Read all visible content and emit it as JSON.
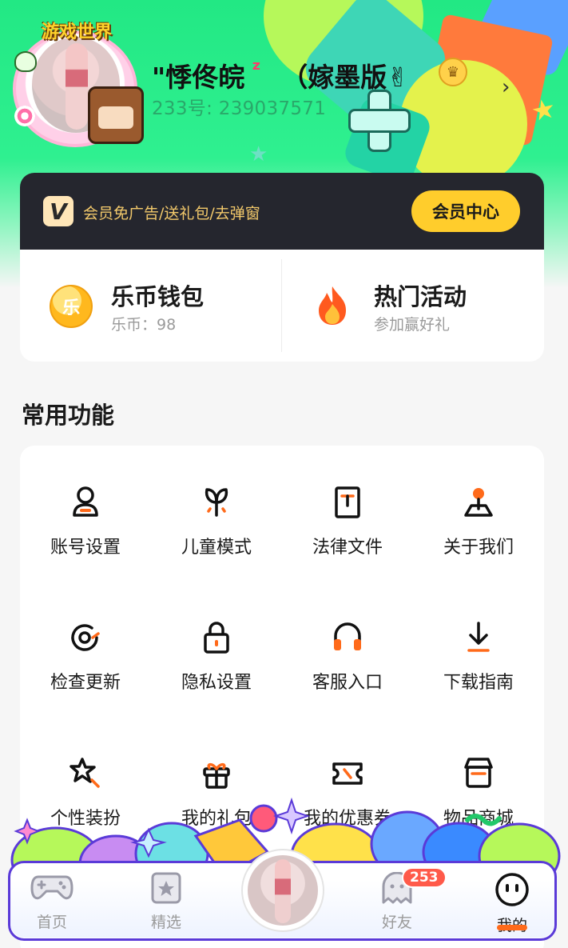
{
  "profile": {
    "username": "\"悸佟皖",
    "username_suffix": "（嫁墨版✌",
    "id_label": "233号: 239037571",
    "logo_text": "游戏世界",
    "icons": [
      "skull-sticker",
      "candy-sticker",
      "lollipop-sticker",
      "mascot-sticker",
      "crown-icon",
      "chevron-right-icon"
    ]
  },
  "vip": {
    "text": "会员免广告/送礼包/去弹窗",
    "button_label": "会员中心",
    "icon_letter": "V"
  },
  "wallet": {
    "coin_glyph": "乐",
    "title": "乐币钱包",
    "subtitle": "乐币：98"
  },
  "activity": {
    "title": "热门活动",
    "subtitle": "参加赢好礼"
  },
  "functions": {
    "section_title": "常用功能",
    "items": [
      {
        "label": "账号设置",
        "icon": "user-icon"
      },
      {
        "label": "儿童模式",
        "icon": "sprout-icon"
      },
      {
        "label": "法律文件",
        "icon": "document-icon"
      },
      {
        "label": "关于我们",
        "icon": "map-pin-icon"
      },
      {
        "label": "检查更新",
        "icon": "refresh-icon"
      },
      {
        "label": "隐私设置",
        "icon": "lock-icon"
      },
      {
        "label": "客服入口",
        "icon": "headset-icon"
      },
      {
        "label": "下载指南",
        "icon": "download-icon"
      },
      {
        "label": "个性装扮",
        "icon": "star-wand-icon"
      },
      {
        "label": "我的礼包",
        "icon": "gift-icon"
      },
      {
        "label": "我的优惠券",
        "icon": "ticket-icon"
      },
      {
        "label": "物品商城",
        "icon": "store-icon"
      }
    ]
  },
  "tabbar": {
    "tabs": [
      {
        "label": "首页",
        "icon": "gamepad-icon",
        "active": false
      },
      {
        "label": "精选",
        "icon": "featured-star-icon",
        "active": false
      },
      {
        "label": "",
        "icon": "avatar",
        "active": false
      },
      {
        "label": "好友",
        "icon": "ghost-friends-icon",
        "active": false
      },
      {
        "label": "我的",
        "icon": "smile-face-icon",
        "active": true
      }
    ],
    "friends_badge": "253"
  },
  "colors": {
    "header_green": "#22e884",
    "vip_dark": "#25262e",
    "vip_gold": "#ffcd2c",
    "accent_orange": "#ff6a1a",
    "badge_red": "#ff5a4a",
    "tab_border": "#5a3ad8"
  }
}
